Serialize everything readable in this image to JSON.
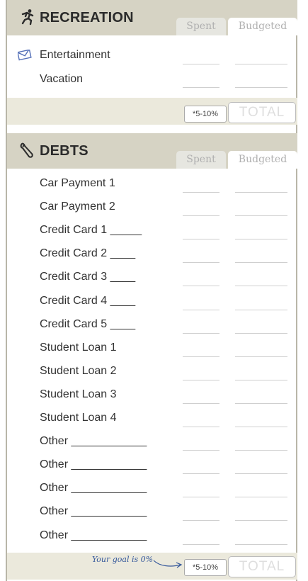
{
  "recreation": {
    "title": "RECREATION",
    "tab_spent": "Spent",
    "tab_budgeted": "Budgeted",
    "items": [
      "Entertainment",
      "Vacation"
    ],
    "pct_label": "*5-10%",
    "total_label": "TOTAL"
  },
  "debts": {
    "title": "DEBTS",
    "tab_spent": "Spent",
    "tab_budgeted": "Budgeted",
    "items": [
      "Car Payment 1",
      "Car Payment 2",
      "Credit Card 1 _____",
      "Credit Card 2 ____",
      "Credit Card 3 ____",
      "Credit Card 4 ____",
      "Credit Card 5 ____",
      "Student Loan 1",
      "Student Loan 2",
      "Student Loan 3",
      "Student Loan 4",
      "Other ____________",
      "Other ____________",
      "Other ____________",
      "Other ____________",
      "Other ____________"
    ],
    "goal_note": "Your goal is 0%",
    "pct_label": "*5-10%",
    "total_label": "TOTAL"
  },
  "colors": {
    "header_bg": "#d6d3c4",
    "total_bg": "#ebe9dc",
    "note_ink": "#34579a"
  }
}
